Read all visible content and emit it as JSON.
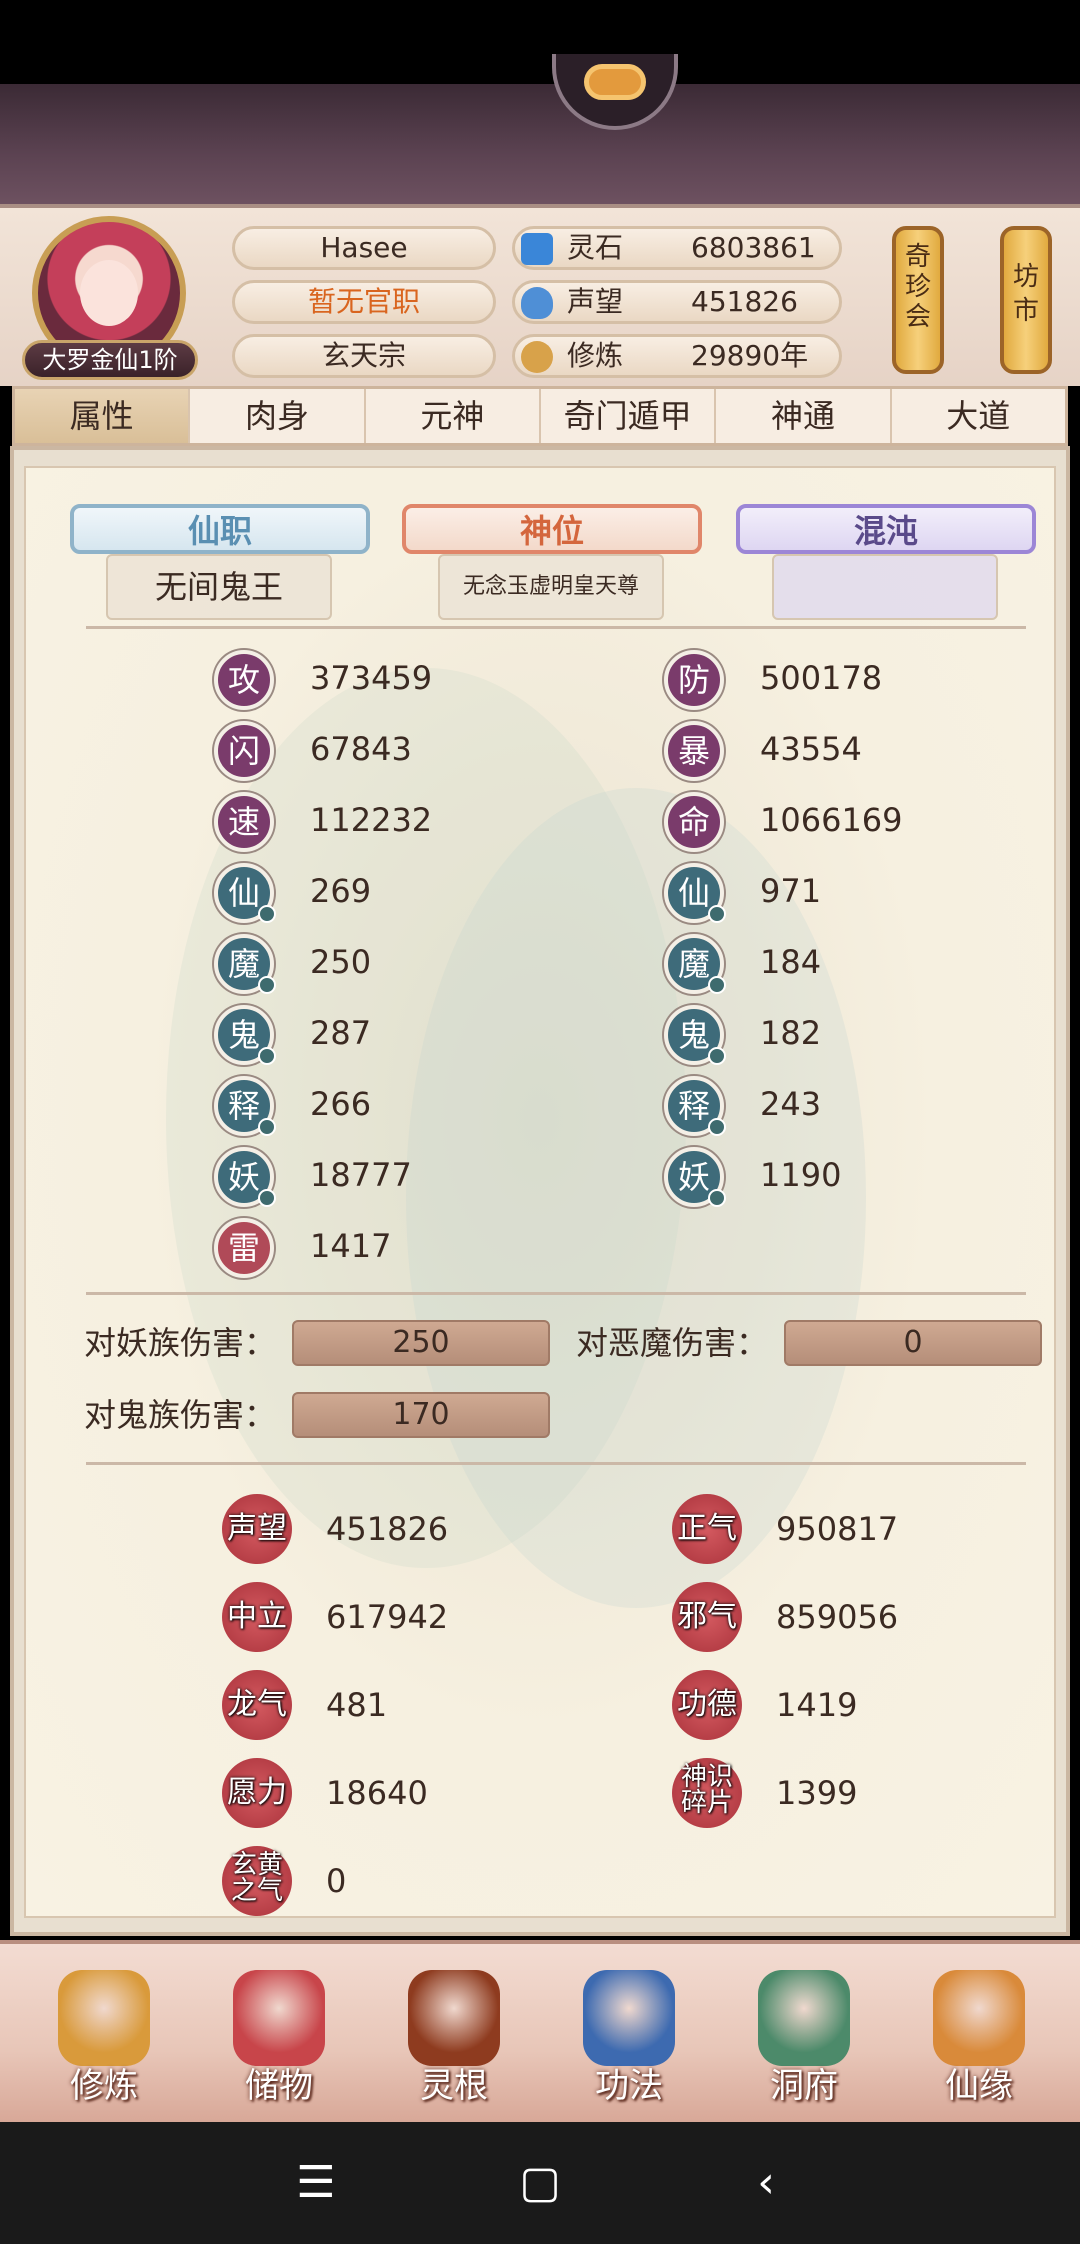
{
  "header": {
    "rank": "大罗金仙1阶",
    "player_name": "Hasee",
    "official_title": "暂无官职",
    "sect": "玄天宗",
    "resources": [
      {
        "label": "灵石",
        "value": "6803861",
        "icon": "spirit-stone-icon",
        "color": "#3a86d8"
      },
      {
        "label": "声望",
        "value": "451826",
        "icon": "prestige-crystal-icon",
        "color": "#4f8fd6"
      },
      {
        "label": "修炼",
        "value": "29890年",
        "icon": "meditation-icon",
        "color": "#d8a24a"
      }
    ],
    "lantern_left": "奇珍会",
    "lantern_right": "坊市"
  },
  "tabs": [
    "属性",
    "肉身",
    "元神",
    "奇门遁甲",
    "神通",
    "大道"
  ],
  "active_tab": 0,
  "titles": [
    {
      "label": "仙职",
      "value": "无间鬼王",
      "color": "#5a8fb2"
    },
    {
      "label": "神位",
      "value": "无念玉虚明皇天尊",
      "color": "#d4663d"
    },
    {
      "label": "混沌",
      "value": "",
      "color": "#7a5cc0"
    }
  ],
  "stats_left": [
    {
      "icon": "攻",
      "value": "373459",
      "color": "#7a3b6b"
    },
    {
      "icon": "闪",
      "value": "67843",
      "color": "#7a3b6b"
    },
    {
      "icon": "速",
      "value": "112232",
      "color": "#7a3b6b"
    },
    {
      "icon": "仙",
      "value": "269",
      "color": "#3e6b7a"
    },
    {
      "icon": "魔",
      "value": "250",
      "color": "#3e6b7a"
    },
    {
      "icon": "鬼",
      "value": "287",
      "color": "#3e6b7a"
    },
    {
      "icon": "释",
      "value": "266",
      "color": "#3e6b7a"
    },
    {
      "icon": "妖",
      "value": "18777",
      "color": "#3e6b7a"
    },
    {
      "icon": "雷",
      "value": "1417",
      "color": "#b04a58"
    }
  ],
  "stats_right": [
    {
      "icon": "防",
      "value": "500178",
      "color": "#7a3b6b"
    },
    {
      "icon": "暴",
      "value": "43554",
      "color": "#7a3b6b"
    },
    {
      "icon": "命",
      "value": "1066169",
      "color": "#7a3b6b"
    },
    {
      "icon": "仙",
      "value": "971",
      "color": "#3e6b7a"
    },
    {
      "icon": "魔",
      "value": "184",
      "color": "#3e6b7a"
    },
    {
      "icon": "鬼",
      "value": "182",
      "color": "#3e6b7a"
    },
    {
      "icon": "释",
      "value": "243",
      "color": "#3e6b7a"
    },
    {
      "icon": "妖",
      "value": "1190",
      "color": "#3e6b7a"
    }
  ],
  "damage": [
    {
      "label": "对妖族伤害：",
      "value": "250"
    },
    {
      "label": "对恶魔伤害：",
      "value": "0"
    },
    {
      "label": "对鬼族伤害：",
      "value": "170"
    }
  ],
  "reputation": [
    {
      "label": "声望",
      "value": "451826"
    },
    {
      "label": "正气",
      "value": "950817"
    },
    {
      "label": "中立",
      "value": "617942"
    },
    {
      "label": "邪气",
      "value": "859056"
    },
    {
      "label": "龙气",
      "value": "481"
    },
    {
      "label": "功德",
      "value": "1419"
    },
    {
      "label": "愿力",
      "value": "18640"
    },
    {
      "label": "神识碎片",
      "value": "1399"
    },
    {
      "label": "玄黄之气",
      "value": "0"
    }
  ],
  "bottom_nav": [
    {
      "label": "修炼",
      "icon": "cultivate-icon",
      "color": "#d99a3b"
    },
    {
      "label": "储物",
      "icon": "storage-bag-icon",
      "color": "#c8454a"
    },
    {
      "label": "灵根",
      "icon": "spirit-root-icon",
      "color": "#8e3b1f"
    },
    {
      "label": "功法",
      "icon": "technique-book-icon",
      "color": "#3d6ab0"
    },
    {
      "label": "洞府",
      "icon": "cave-dwelling-icon",
      "color": "#4c8a6a"
    },
    {
      "label": "仙缘",
      "icon": "gourd-icon",
      "color": "#d98a3a"
    }
  ],
  "system_nav": [
    "☰",
    "▢",
    "‹"
  ]
}
